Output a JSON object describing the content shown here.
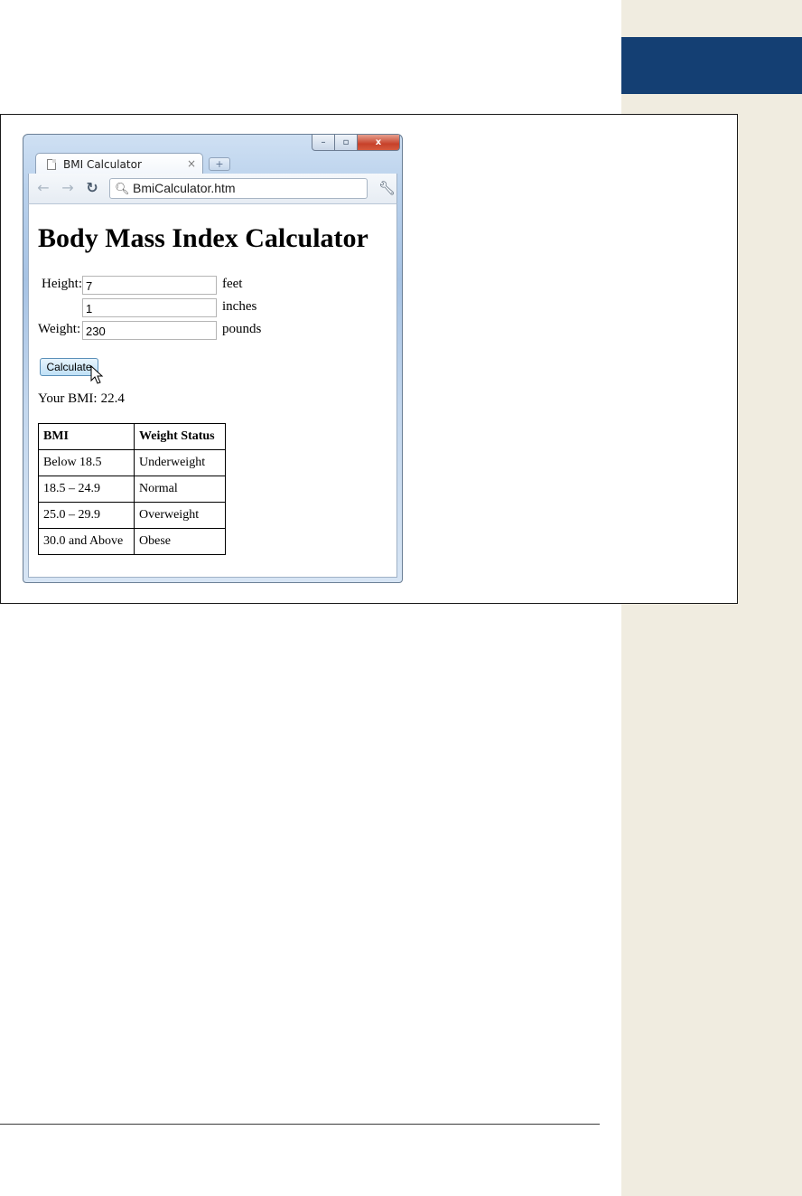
{
  "browser": {
    "tab_title": "BMI Calculator",
    "tab_close": "×",
    "new_tab": "+",
    "url": "BmiCalculator.htm",
    "window_controls": {
      "minimize": "–",
      "maximize": "▫",
      "close": "x"
    }
  },
  "page": {
    "heading": "Body Mass Index Calculator",
    "height_label": "Height:",
    "height_feet_value": "7",
    "feet_unit": "feet",
    "height_inches_value": "1",
    "inches_unit": "inches",
    "weight_label": "Weight:",
    "weight_value": "230",
    "pounds_unit": "pounds",
    "calculate_label": "Calculate",
    "result_label": "Your BMI:",
    "result_value": "22.4"
  },
  "table": {
    "headers": [
      "BMI",
      "Weight Status"
    ],
    "rows": [
      [
        "Below 18.5",
        "Underweight"
      ],
      [
        "18.5 – 24.9",
        "Normal"
      ],
      [
        "25.0 – 29.9",
        "Overweight"
      ],
      [
        "30.0 and Above",
        "Obese"
      ]
    ]
  },
  "icons": {
    "back": "back-arrow-icon",
    "forward": "forward-arrow-icon",
    "reload": "reload-icon",
    "search": "search-icon",
    "settings": "wrench-icon",
    "cursor": "mouse-pointer-icon"
  },
  "colors": {
    "side_band": "#f0ece0",
    "side_tab": "#143f73",
    "close_button": "#c7412a",
    "calculate_button": "#bfe0f6"
  }
}
